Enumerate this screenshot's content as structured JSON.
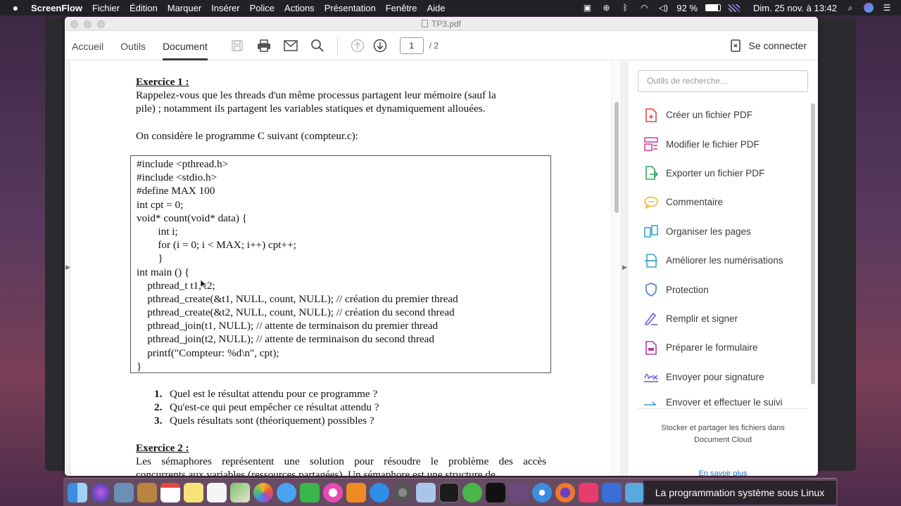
{
  "menubar": {
    "app": "ScreenFlow",
    "menus": [
      "Fichier",
      "Édition",
      "Marquer",
      "Insérer",
      "Police",
      "Actions",
      "Présentation",
      "Fenêtre",
      "Aide"
    ],
    "battery": "92 %",
    "datetime": "Dim. 25 nov. à 13:42"
  },
  "window": {
    "title": "TP3.pdf"
  },
  "toolbar": {
    "tabs": [
      "Accueil",
      "Outils",
      "Document"
    ],
    "active_tab": "Document",
    "page_current": "1",
    "page_total": "/ 2",
    "connect_label": "Se connecter"
  },
  "document": {
    "ex1_title": "Exercice 1 :",
    "ex1_line1": "Rappelez-vous que les threads d'un même processus partagent leur mémoire (sauf la",
    "ex1_line2": "pile) ; notamment ils partagent les variables statiques et dynamiquement allouées.",
    "ex1_intro": "On considère le programme C suivant (compteur.c):",
    "code": [
      "#include <pthread.h>",
      "#include <stdio.h>",
      "#define MAX 100",
      "int cpt = 0;",
      "void* count(void* data) {",
      "        int i;",
      "        for (i = 0; i < MAX; i++) cpt++;",
      "        }",
      "int main () {",
      "    pthread_t t1, t2;",
      "    pthread_create(&t1, NULL, count, NULL); // création du premier thread",
      "    pthread_create(&t2, NULL, count, NULL); // création du second thread",
      "    pthread_join(t1, NULL); // attente de terminaison du premier thread",
      "    pthread_join(t2, NULL); // attente de terminaison du second thread",
      "    printf(\"Compteur: %d\\n\", cpt);",
      "}"
    ],
    "questions": [
      {
        "num": "1.",
        "text": "Quel est le résultat attendu pour ce programme ?"
      },
      {
        "num": "2.",
        "text": "Qu'est-ce qui peut empêcher ce résultat attendu ?"
      },
      {
        "num": "3.",
        "text": "Quels résultats sont (théoriquement) possibles ?"
      }
    ],
    "ex2_title": "Exercice 2 :",
    "ex2_line1": "Les sémaphores représentent une solution pour résoudre le problème des accès",
    "ex2_line2": "concurrents aux variables (ressources partagées). Un sémaphore est une structure de"
  },
  "rpanel": {
    "search_placeholder": "Outils de recherche...",
    "tools": [
      {
        "label": "Créer un fichier PDF",
        "icon": "create-pdf-icon",
        "color": "#e2464d"
      },
      {
        "label": "Modifier le fichier PDF",
        "icon": "edit-pdf-icon",
        "color": "#d943a0"
      },
      {
        "label": "Exporter un fichier PDF",
        "icon": "export-pdf-icon",
        "color": "#37a35b"
      },
      {
        "label": "Commentaire",
        "icon": "comment-icon",
        "color": "#f2b42d"
      },
      {
        "label": "Organiser les pages",
        "icon": "organize-pages-icon",
        "color": "#3aa4c4"
      },
      {
        "label": "Améliorer les numérisations",
        "icon": "scan-icon",
        "color": "#3aa4c4"
      },
      {
        "label": "Protection",
        "icon": "shield-icon",
        "color": "#3f7bd6"
      },
      {
        "label": "Remplir et signer",
        "icon": "fill-sign-icon",
        "color": "#7a5fd1"
      },
      {
        "label": "Préparer le formulaire",
        "icon": "form-icon",
        "color": "#b03fa8"
      },
      {
        "label": "Envoyer pour signature",
        "icon": "send-signature-icon",
        "color": "#6b5ad0"
      },
      {
        "label": "Envoyer et effectuer le suivi",
        "icon": "send-track-icon",
        "color": "#3aa4c4"
      }
    ],
    "cloud_line1": "Stocker et partager les fichiers dans",
    "cloud_line2": "Document Cloud",
    "learn_more": "En savoir plus"
  },
  "banner": "La programmation système sous Linux"
}
